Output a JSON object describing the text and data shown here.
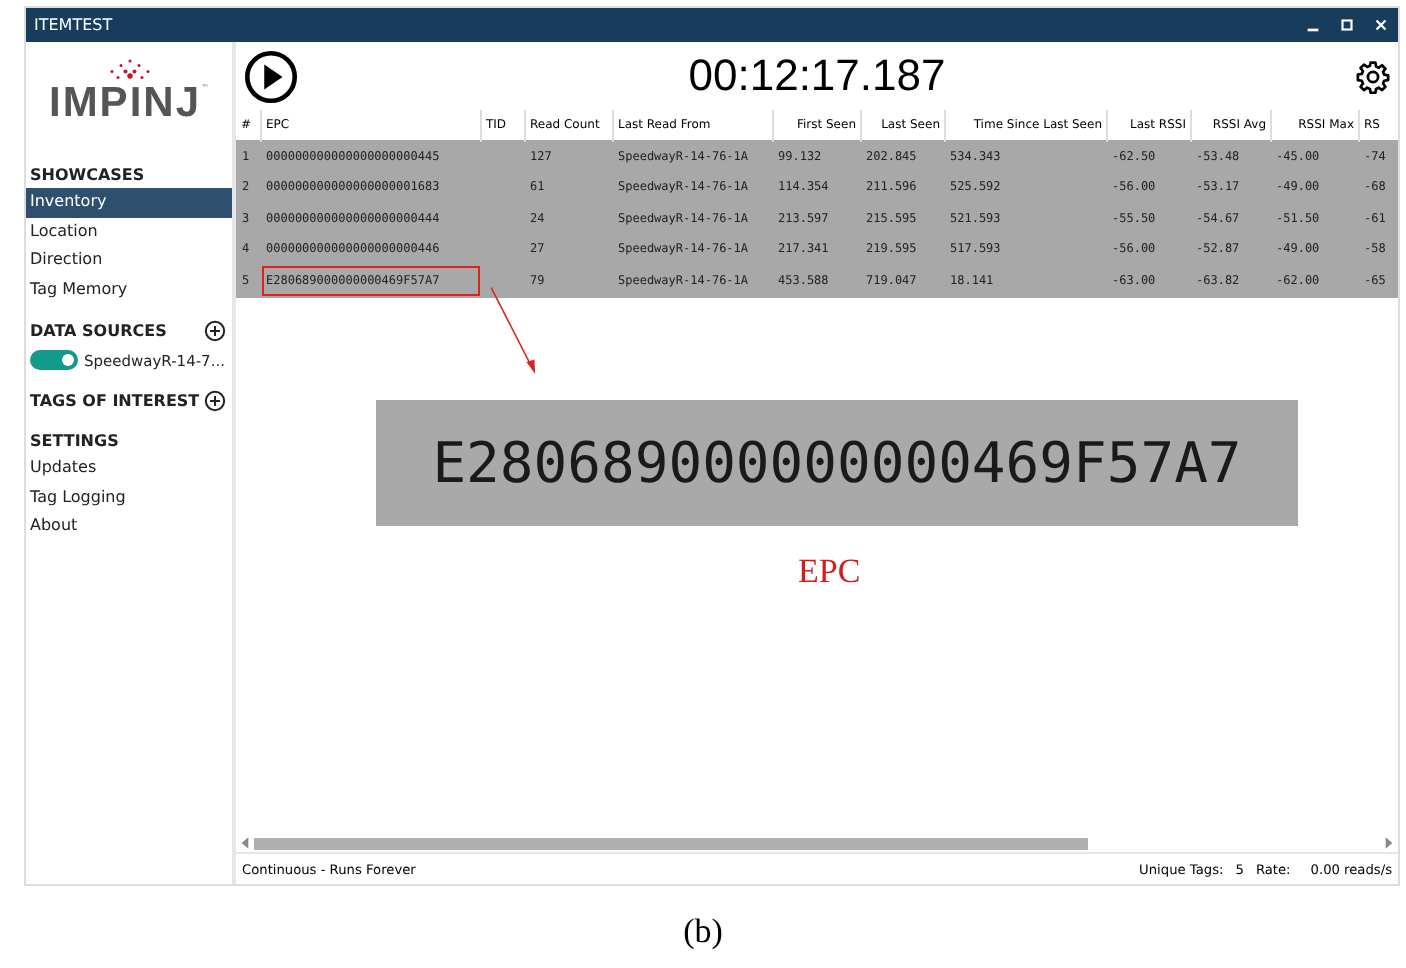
{
  "window": {
    "title": "ITEMTEST"
  },
  "logo": {
    "text": "IMPINJ",
    "mark": "™"
  },
  "sidebar": {
    "sections": [
      {
        "kind": "list",
        "title": "SHOWCASES",
        "items": [
          {
            "label": "Inventory",
            "selected": true
          },
          {
            "label": "Location",
            "selected": false
          },
          {
            "label": "Direction",
            "selected": false
          },
          {
            "label": "Tag Memory",
            "selected": false
          }
        ]
      },
      {
        "kind": "sources",
        "title": "DATA SOURCES",
        "sources": [
          {
            "label": "SpeedwayR-14-7...",
            "on": true
          }
        ]
      },
      {
        "kind": "add",
        "title": "TAGS OF INTEREST"
      },
      {
        "kind": "list",
        "title": "SETTINGS",
        "items": [
          {
            "label": "Updates",
            "selected": false
          },
          {
            "label": "Tag Logging",
            "selected": false
          },
          {
            "label": "About",
            "selected": false
          }
        ]
      }
    ]
  },
  "timer": "00:12:17.187",
  "table": {
    "columns": [
      "#",
      "EPC",
      "TID",
      "Read Count",
      "Last Read From",
      "First Seen",
      "Last Seen",
      "Time Since Last Seen",
      "Last RSSI",
      "RSSI Avg",
      "RSSI Max",
      "RS"
    ],
    "rows": [
      {
        "highlighted": false,
        "cells": [
          "1",
          "000000000000000000000445",
          "",
          "127",
          "SpeedwayR-14-76-1A",
          "99.132",
          "202.845",
          "534.343",
          "-62.50",
          "-53.48",
          "-45.00",
          "-74"
        ]
      },
      {
        "highlighted": false,
        "cells": [
          "2",
          "000000000000000000001683",
          "",
          "61",
          "SpeedwayR-14-76-1A",
          "114.354",
          "211.596",
          "525.592",
          "-56.00",
          "-53.17",
          "-49.00",
          "-68"
        ]
      },
      {
        "highlighted": false,
        "cells": [
          "3",
          "000000000000000000000444",
          "",
          "24",
          "SpeedwayR-14-76-1A",
          "213.597",
          "215.595",
          "521.593",
          "-55.50",
          "-54.67",
          "-51.50",
          "-61"
        ]
      },
      {
        "highlighted": false,
        "cells": [
          "4",
          "000000000000000000000446",
          "",
          "27",
          "SpeedwayR-14-76-1A",
          "217.341",
          "219.595",
          "517.593",
          "-56.00",
          "-52.87",
          "-49.00",
          "-58"
        ]
      },
      {
        "highlighted": true,
        "cells": [
          "5",
          "E280689000000000469F57A7",
          "",
          "79",
          "SpeedwayR-14-76-1A",
          "453.588",
          "719.047",
          "18.141",
          "-63.00",
          "-63.82",
          "-62.00",
          "-65"
        ]
      }
    ]
  },
  "status_bar": {
    "mode": "Continuous - Runs Forever",
    "unique_label": "Unique Tags:",
    "unique_count": "5",
    "rate_label": "Rate:",
    "rate": "0.00 reads/s"
  },
  "annotation": {
    "zoomed_text": "E280689000000000469F57A7",
    "label": "EPC"
  },
  "caption": "(b)"
}
